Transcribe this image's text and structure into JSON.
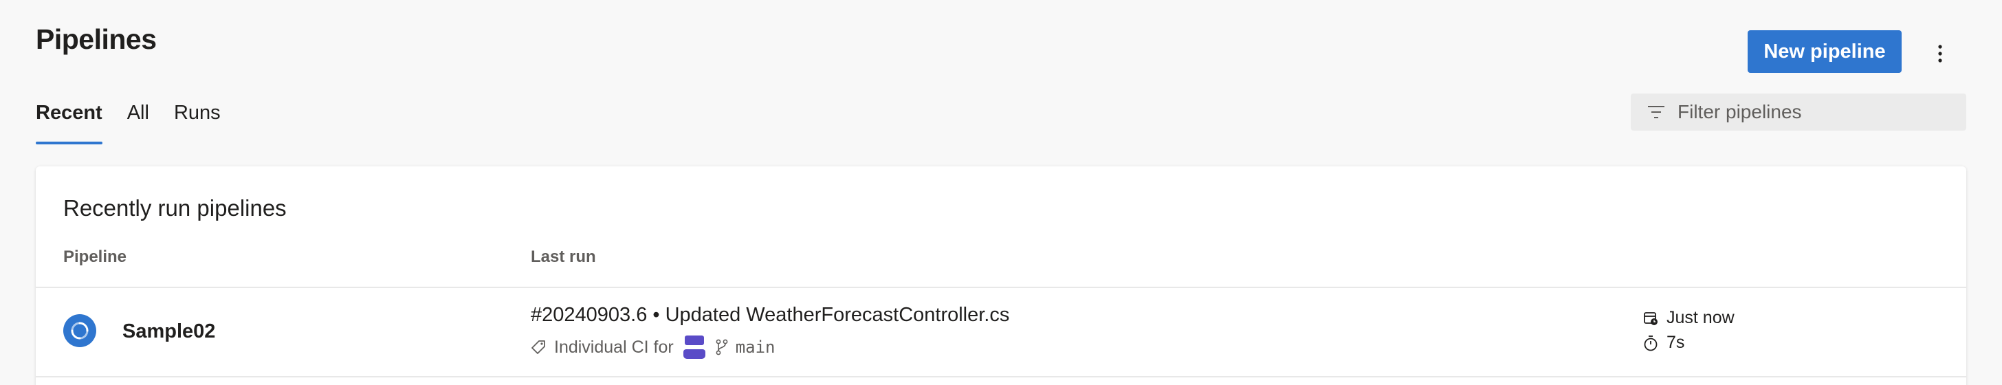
{
  "header": {
    "title": "Pipelines",
    "new_button_label": "New pipeline",
    "more_icon": "more-vertical-icon"
  },
  "tabs": [
    {
      "label": "Recent",
      "active": true
    },
    {
      "label": "All",
      "active": false
    },
    {
      "label": "Runs",
      "active": false
    }
  ],
  "filter": {
    "placeholder": "Filter pipelines",
    "value": "",
    "icon": "filter-icon"
  },
  "card": {
    "title": "Recently run pipelines",
    "columns": {
      "pipeline": "Pipeline",
      "last_run": "Last run"
    },
    "rows": [
      {
        "name": "Sample02",
        "status_icon": "in-progress-icon",
        "run_title": "#20240903.6 • Updated WeatherForecastController.cs",
        "trigger": "Individual CI for",
        "branch": "main",
        "queued": "Just now",
        "duration": "7s"
      }
    ]
  },
  "colors": {
    "accent": "#2f76cf",
    "avatar": "#5a4bc7"
  }
}
